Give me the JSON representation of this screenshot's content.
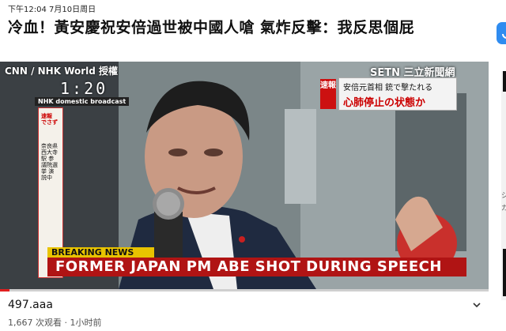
{
  "status_bar": {
    "time": "下午12:04",
    "date": "7月10日周日"
  },
  "video_title": "冷血！黃安慶祝安倍過世被中國人嗆 氣炸反擊：我反思個屁",
  "share_button": {
    "icon": "share-icon",
    "color": "#2f8cf0"
  },
  "player": {
    "progress_fraction": 0.02,
    "accent": "#e02020",
    "overlays": {
      "source": "CNN / NHK World 授權",
      "clock": "1:20",
      "nhk_label": "NHK domestic broadcast",
      "side_caption_title": "速報 でさず",
      "side_caption_body": "奈良県 西大寺駅 参議院選挙 演説中",
      "network_logo": "SETN 三立新聞網",
      "alert_tag": "速報",
      "alert_line1": "安倍元首相 銃で撃たれる",
      "alert_line2": "心肺停止の状態か",
      "breaking_label": "BREAKING NEWS",
      "headline": "FORMER JAPAN PM ABE SHOT DURING SPEECH"
    }
  },
  "channel": {
    "name": "497.aaa",
    "views": "1,667 次观看",
    "separator": "·",
    "age": "1小时前"
  },
  "more_button": {
    "icon": "chevron-down-icon"
  }
}
